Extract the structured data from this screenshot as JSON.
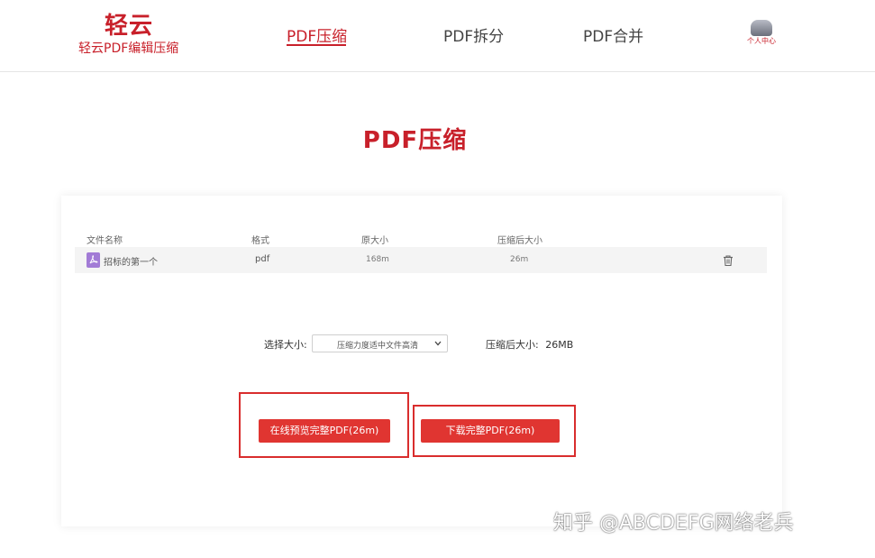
{
  "header": {
    "logo_main": "轻云",
    "logo_sub": "轻云PDF编辑压缩",
    "nav": [
      {
        "label": "PDF压缩",
        "active": true
      },
      {
        "label": "PDF拆分",
        "active": false
      },
      {
        "label": "PDF合并",
        "active": false
      }
    ],
    "user_center_label": "个人中心"
  },
  "page_title": "PDF压缩",
  "table": {
    "headers": [
      "文件名称",
      "格式",
      "原大小",
      "压缩后大小"
    ],
    "rows": [
      {
        "name": "招标的第一个",
        "format": "pdf",
        "original_size": "168m",
        "compressed_size": "26m",
        "icon": "pdf-file-icon"
      }
    ]
  },
  "options": {
    "size_label": "选择大小:",
    "size_selected": "压缩力度适中文件高清",
    "after_label": "压缩后大小:",
    "after_value": "26MB"
  },
  "buttons": {
    "preview": "在线预览完整PDF(26m)",
    "download": "下载完整PDF(26m)"
  },
  "colors": {
    "accent": "#c8202a",
    "button": "#e03531",
    "highlight_box": "#d92d2d"
  },
  "watermark": "知乎 @ABCDEFG网络老兵"
}
